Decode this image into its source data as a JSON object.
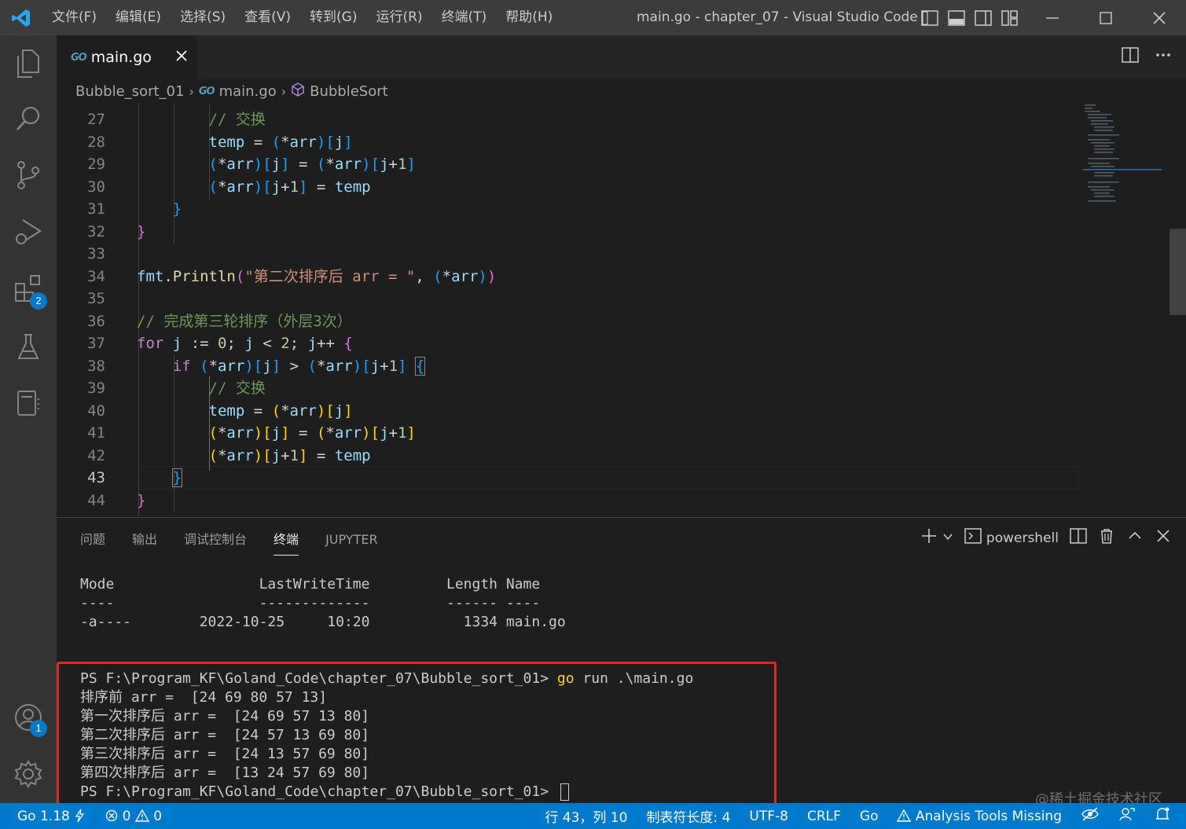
{
  "titlebar": {
    "menu": [
      "文件(F)",
      "编辑(E)",
      "选择(S)",
      "查看(V)",
      "转到(G)",
      "运行(R)",
      "终端(T)",
      "帮助(H)"
    ],
    "title": "main.go - chapter_07 - Visual Studio Code"
  },
  "activity": {
    "extensions_badge": "2",
    "accounts_badge": "1"
  },
  "tab": {
    "icon_text": "GO",
    "label": "main.go"
  },
  "breadcrumb": {
    "folder": "Bubble_sort_01",
    "file": "main.go",
    "symbol": "BubbleSort"
  },
  "editor": {
    "line_numbers": [
      "27",
      "28",
      "29",
      "30",
      "31",
      "32",
      "33",
      "34",
      "35",
      "36",
      "37",
      "38",
      "39",
      "40",
      "41",
      "42",
      "43",
      "44"
    ],
    "active_line": "43"
  },
  "panel": {
    "tabs": [
      "问题",
      "输出",
      "调试控制台",
      "终端",
      "JUPYTER"
    ],
    "active_tab": "终端",
    "shell": "powershell"
  },
  "terminal": {
    "header": "Mode                 LastWriteTime         Length Name",
    "underline": "----                 -------------         ------ ----",
    "file_row": "-a----        2022-10-25     10:20           1334 main.go",
    "prompt": "PS F:\\Program_KF\\Goland_Code\\chapter_07\\Bubble_sort_01> ",
    "cmd_go": "go",
    "cmd_rest": " run .\\main.go",
    "out1": "排序前 arr =  [24 69 80 57 13]",
    "out2": "第一次排序后 arr =  [24 69 57 13 80]",
    "out3": "第二次排序后 arr =  [24 57 13 69 80]",
    "out4": "第三次排序后 arr =  [24 13 57 69 80]",
    "out5": "第四次排序后 arr =  [13 24 57 69 80]",
    "prompt2": "PS F:\\Program_KF\\Goland_Code\\chapter_07\\Bubble_sort_01> "
  },
  "watermark": "@稀土掘金技术社区",
  "statusbar": {
    "go_version": "Go 1.18",
    "errors": "0",
    "warnings": "0",
    "position": "行 43，列 10",
    "tab_size": "制表符长度: 4",
    "encoding": "UTF-8",
    "eol": "CRLF",
    "language": "Go",
    "analysis": "Analysis Tools Missing"
  },
  "colors": {
    "accent": "#007acc",
    "highlight": "#e0282a"
  }
}
